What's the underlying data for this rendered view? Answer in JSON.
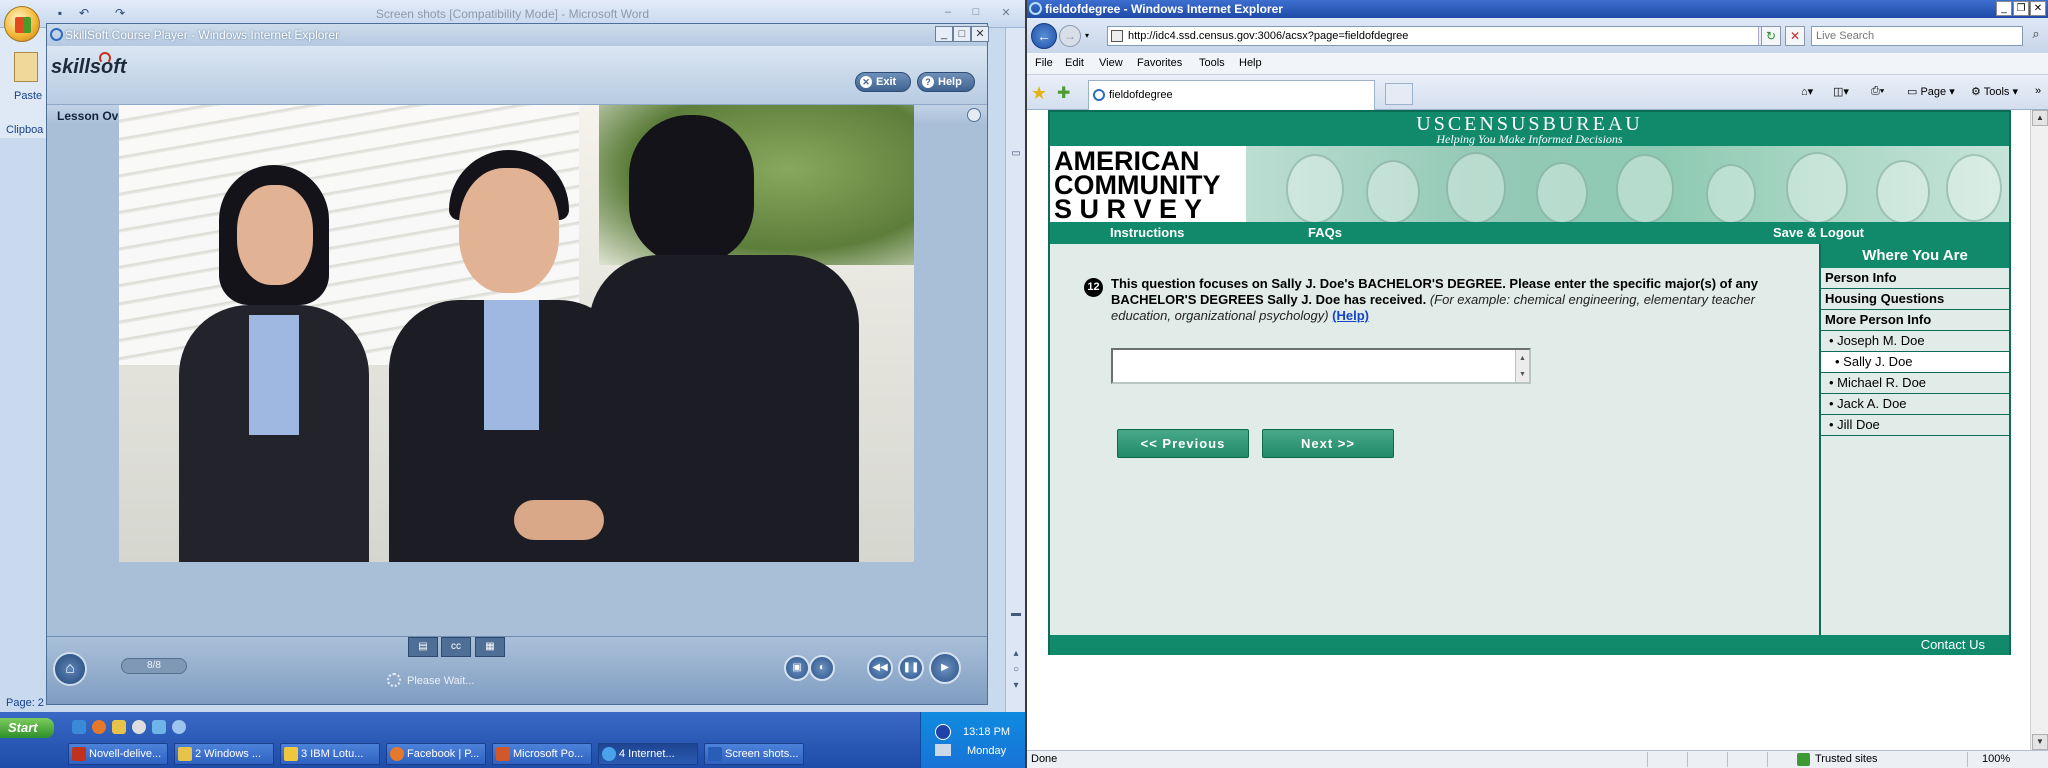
{
  "word": {
    "title": "Screen shots [Compatibility Mode] - Microsoft Word",
    "paste_label": "Paste",
    "clipboard_label": "Clipboa",
    "page_label": "Page: 2"
  },
  "skillsoft": {
    "window_title": "SkillSoft Course Player - Windows Internet Explorer",
    "logo_text": "skillsoft",
    "exit_label": "Exit",
    "help_label": "Help",
    "lesson_title": "Lesson Overview",
    "page_counter": "8/8",
    "wait_text": "Please Wait..."
  },
  "taskbar": {
    "start_label": "Start",
    "buttons": [
      {
        "label": "Novell-delive..."
      },
      {
        "label": "2 Windows ..."
      },
      {
        "label": "3 IBM Lotu..."
      },
      {
        "label": "Facebook | P..."
      },
      {
        "label": "Microsoft Po..."
      },
      {
        "label": "4 Internet..."
      },
      {
        "label": "Screen shots..."
      }
    ],
    "clock": "13:18 PM",
    "day": "Monday"
  },
  "ie": {
    "window_title": "fieldofdegree - Windows Internet Explorer",
    "url": "http://idc4.ssd.census.gov:3006/acsx?page=fieldofdegree",
    "search_placeholder": "Live Search",
    "menus": [
      "File",
      "Edit",
      "View",
      "Favorites",
      "Tools",
      "Help"
    ],
    "tab_label": "fieldofdegree",
    "page_cmd": "Page",
    "tools_cmd": "Tools",
    "status_done": "Done",
    "status_zone": "Trusted sites",
    "status_zoom": "100%"
  },
  "census": {
    "bureau_name": "USCENSUSBUREAU",
    "bureau_tagline": "Helping You Make Informed Decisions",
    "logo_lines": [
      "AMERICAN",
      "COMMUNITY",
      "S U R V E Y"
    ],
    "nav": {
      "instructions": "Instructions",
      "faqs": "FAQs",
      "save_logout": "Save & Logout"
    },
    "question": {
      "number": "12",
      "bold_text": "This question focuses on Sally J. Doe's BACHELOR'S DEGREE. Please enter the specific major(s) of any BACHELOR'S DEGREES Sally J. Doe has received.",
      "example_text": "(For example: chemical engineering, elementary teacher education, organizational psychology)",
      "help_link": "(Help)",
      "answer_value": ""
    },
    "previous_label": "<<  Previous",
    "next_label": "Next  >>",
    "sidebar": {
      "title": "Where You Are",
      "items": [
        {
          "label": "Person Info"
        },
        {
          "label": "Housing Questions"
        },
        {
          "label": "More Person Info"
        },
        {
          "label": "• Joseph M. Doe"
        },
        {
          "label": "• Sally J. Doe"
        },
        {
          "label": "• Michael R. Doe"
        },
        {
          "label": "• Jack A. Doe"
        },
        {
          "label": "• Jill Doe"
        }
      ]
    },
    "footer_contact": "Contact Us",
    "colors": {
      "brand_green": "#118a6c",
      "page_background": "#e1ebe7",
      "link_blue": "#1645c6"
    }
  }
}
